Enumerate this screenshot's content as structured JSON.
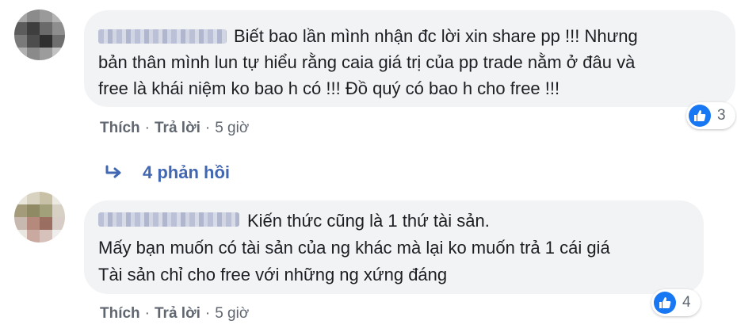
{
  "comments": [
    {
      "lines": [
        "Biết bao lần mình nhận đc lời xin share pp !!! Nhưng",
        "bản thân mình lun tự hiểu rằng caia giá trị của pp trade nằm ở đâu và",
        "free là khái niệm ko bao h có !!! Đồ quý có bao h cho free !!!"
      ],
      "actions": {
        "like": "Thích",
        "reply": "Trả lời",
        "time": "5 giờ",
        "separator": "·"
      },
      "reaction_count": "3",
      "replies_label": "4 phản hồi"
    },
    {
      "lines": [
        "Kiến thức cũng là 1 thứ tài sản.",
        "Mấy bạn muốn có tài sản của ng khác mà lại ko muốn trả 1 cái giá",
        "Tài sản chỉ cho free với những ng xứng đáng"
      ],
      "actions": {
        "like": "Thích",
        "reply": "Trả lời",
        "time": "5 giờ",
        "separator": "·"
      },
      "reaction_count": "4"
    }
  ],
  "colors": {
    "link_blue": "#4267b2",
    "like_blue": "#1877f2",
    "bubble_bg": "#f2f3f5",
    "meta_gray": "#606770"
  },
  "icons": {
    "reaction": "like-thumb-icon",
    "replies": "reply-arrow-icon"
  }
}
